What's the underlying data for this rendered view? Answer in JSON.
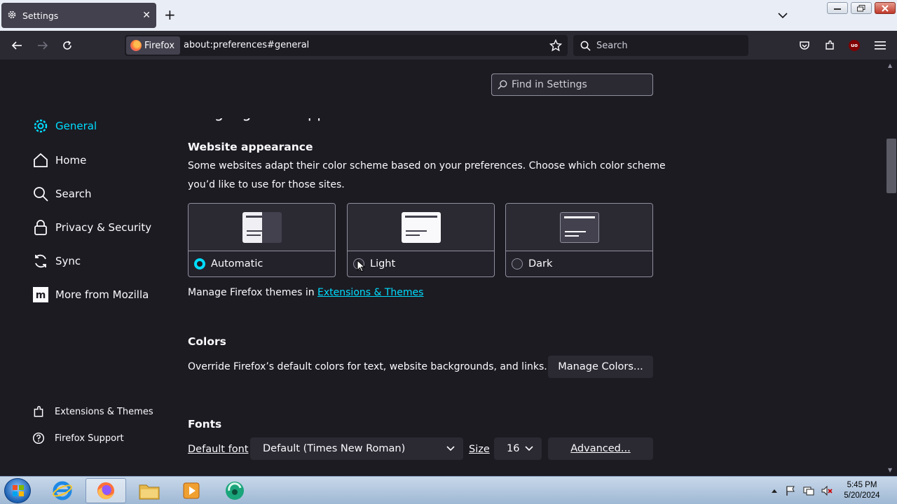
{
  "browser": {
    "tab_title": "Settings",
    "identity_label": "Firefox",
    "url": "about:preferences#general",
    "search_placeholder": "Search"
  },
  "settings": {
    "find_placeholder": "Find in Settings",
    "categories": [
      {
        "label": "General",
        "icon": "gear-icon",
        "selected": true
      },
      {
        "label": "Home",
        "icon": "home-icon"
      },
      {
        "label": "Search",
        "icon": "search-icon"
      },
      {
        "label": "Privacy & Security",
        "icon": "lock-icon"
      },
      {
        "label": "Sync",
        "icon": "sync-icon"
      },
      {
        "label": "More from Mozilla",
        "icon": "mozilla-icon"
      }
    ],
    "footer_links": [
      {
        "label": "Extensions & Themes",
        "icon": "puzzle-icon"
      },
      {
        "label": "Firefox Support",
        "icon": "help-icon"
      }
    ],
    "section_heading": "Language and Appearance",
    "website_appearance": {
      "heading": "Website appearance",
      "description_line1": "Some websites adapt their color scheme based on your preferences. Choose which color scheme",
      "description_line2": "you’d like to use for those sites.",
      "options": [
        {
          "label": "Automatic",
          "checked": true
        },
        {
          "label": "Light",
          "checked": false
        },
        {
          "label": "Dark",
          "checked": false
        }
      ],
      "themes_text": "Manage Firefox themes in ",
      "themes_link": "Extensions & Themes"
    },
    "colors": {
      "heading": "Colors",
      "description": "Override Firefox’s default colors for text, website backgrounds, and links.",
      "button": "Manage Colors..."
    },
    "fonts": {
      "heading": "Fonts",
      "default_font_label": "Default font",
      "default_font_value": "Default (Times New Roman)",
      "size_label": "Size",
      "size_value": "16",
      "advanced_button": "Advanced..."
    }
  },
  "taskbar": {
    "time": "5:45 PM",
    "date": "5/20/2024"
  },
  "colors": {
    "accent": "#00ddff",
    "background": "#1c1b22",
    "surface": "#2b2a33"
  }
}
